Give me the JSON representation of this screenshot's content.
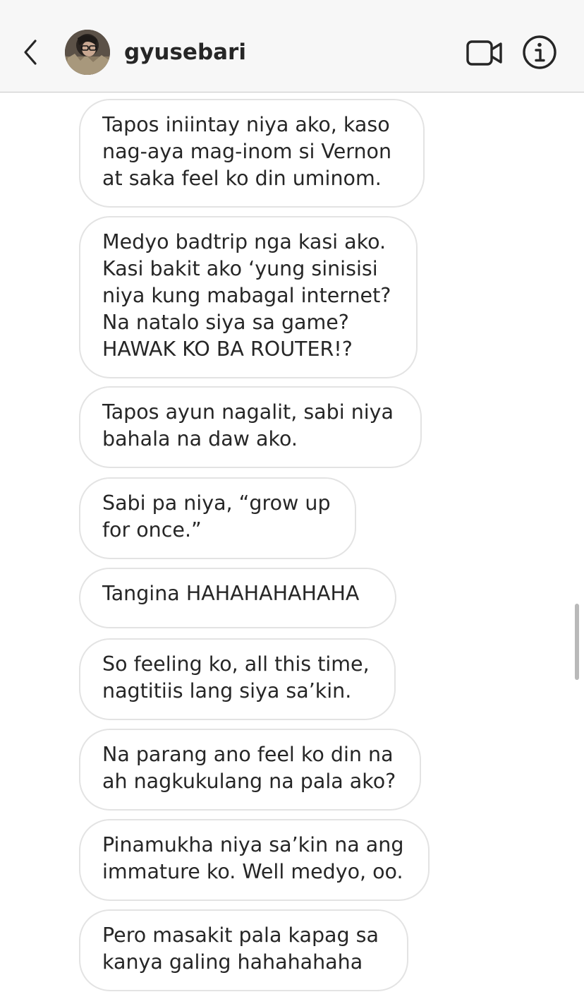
{
  "header": {
    "back_icon": "chevron-left-icon",
    "username": "gyusebari",
    "video_icon": "video-camera-icon",
    "info_icon": "info-circle-icon"
  },
  "messages": [
    {
      "text": "Tapos iniintay niya ako, kaso\nnag-aya mag-inom si Vernon\nat saka feel ko din uminom."
    },
    {
      "text": "Medyo badtrip nga kasi ako.\nKasi bakit ako ‘yung sinisisi\nniya kung mabagal internet?\nNa natalo siya sa game?\nHAWAK KO BA ROUTER!?"
    },
    {
      "text": "Tapos ayun nagalit, sabi niya\nbahala na daw ako."
    },
    {
      "text": "Sabi pa niya, “grow up\nfor once.”"
    },
    {
      "text": "Tangina HAHAHAHAHAHA"
    },
    {
      "text": "So feeling ko, all this time,\nnagtitiis lang siya sa’kin."
    },
    {
      "text": "Na parang ano feel ko din na\nah nagkukulang na pala ako?"
    },
    {
      "text": "Pinamukha niya sa’kin na ang\nimmature ko. Well medyo, oo."
    },
    {
      "text": "Pero masakit pala kapag sa\nkanya galing hahahahaha"
    }
  ]
}
